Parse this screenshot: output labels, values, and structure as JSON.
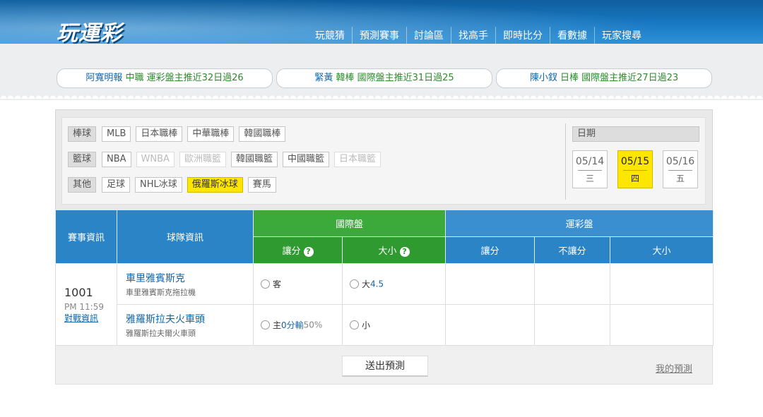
{
  "header": {
    "logo": "玩運彩",
    "nav": [
      "玩競猜",
      "預測賽事",
      "討論區",
      "找高手",
      "即時比分",
      "看數據",
      "玩家搜尋"
    ]
  },
  "ticker": [
    {
      "name": "阿寬明報",
      "text": "中職 運彩盤主推近32日過26"
    },
    {
      "name": "緊黃",
      "text": "韓棒 國際盤主推近31日過25"
    },
    {
      "name": "陳小釵",
      "text": "日棒 國際盤主推近27日過23"
    }
  ],
  "filters": {
    "rows": [
      {
        "category": "棒球",
        "items": [
          "MLB",
          "日本職棒",
          "中華職棒",
          "韓國職棒"
        ]
      },
      {
        "category": "籃球",
        "items": [
          "NBA",
          "WNBA",
          "歐洲職籃",
          "韓國職籃",
          "中國職籃",
          "日本職籃"
        ]
      },
      {
        "category": "其他",
        "items": [
          "足球",
          "NHL冰球",
          "俄羅斯冰球",
          "賽馬"
        ]
      }
    ],
    "selected": "俄羅斯冰球"
  },
  "dates": {
    "label": "日期",
    "items": [
      {
        "date": "05/14",
        "weekday": "三"
      },
      {
        "date": "05/15",
        "weekday": "四"
      },
      {
        "date": "05/16",
        "weekday": "五"
      }
    ],
    "selected": "05/15"
  },
  "table": {
    "headers": {
      "game_info": "賽事資訊",
      "team_info": "球隊資訊",
      "intl": "國際盤",
      "sports_lottery": "運彩盤",
      "intl_handicap": "讓分",
      "intl_total": "大小",
      "help_icon": "?",
      "lot_handicap": "讓分",
      "lot_no_handicap": "不讓分",
      "lot_total": "大小"
    },
    "game": {
      "id": "1001",
      "time": "PM 11:59",
      "link": "對戰資訊",
      "away": {
        "name": "車里雅賓斯克",
        "sub": "車里雅賓斯克拖拉機",
        "handicap_label": "客",
        "total_label": "大",
        "total_value": "4.5"
      },
      "home": {
        "name": "雅羅斯拉夫火車頭",
        "sub": "雅羅斯拉夫爾火車頭",
        "handicap_label": "主",
        "handicap_value": "0分輸",
        "handicap_pct": "50%",
        "total_label": "小"
      }
    }
  },
  "footer": {
    "submit": "送出預測",
    "my_predictions": "我的預測"
  }
}
